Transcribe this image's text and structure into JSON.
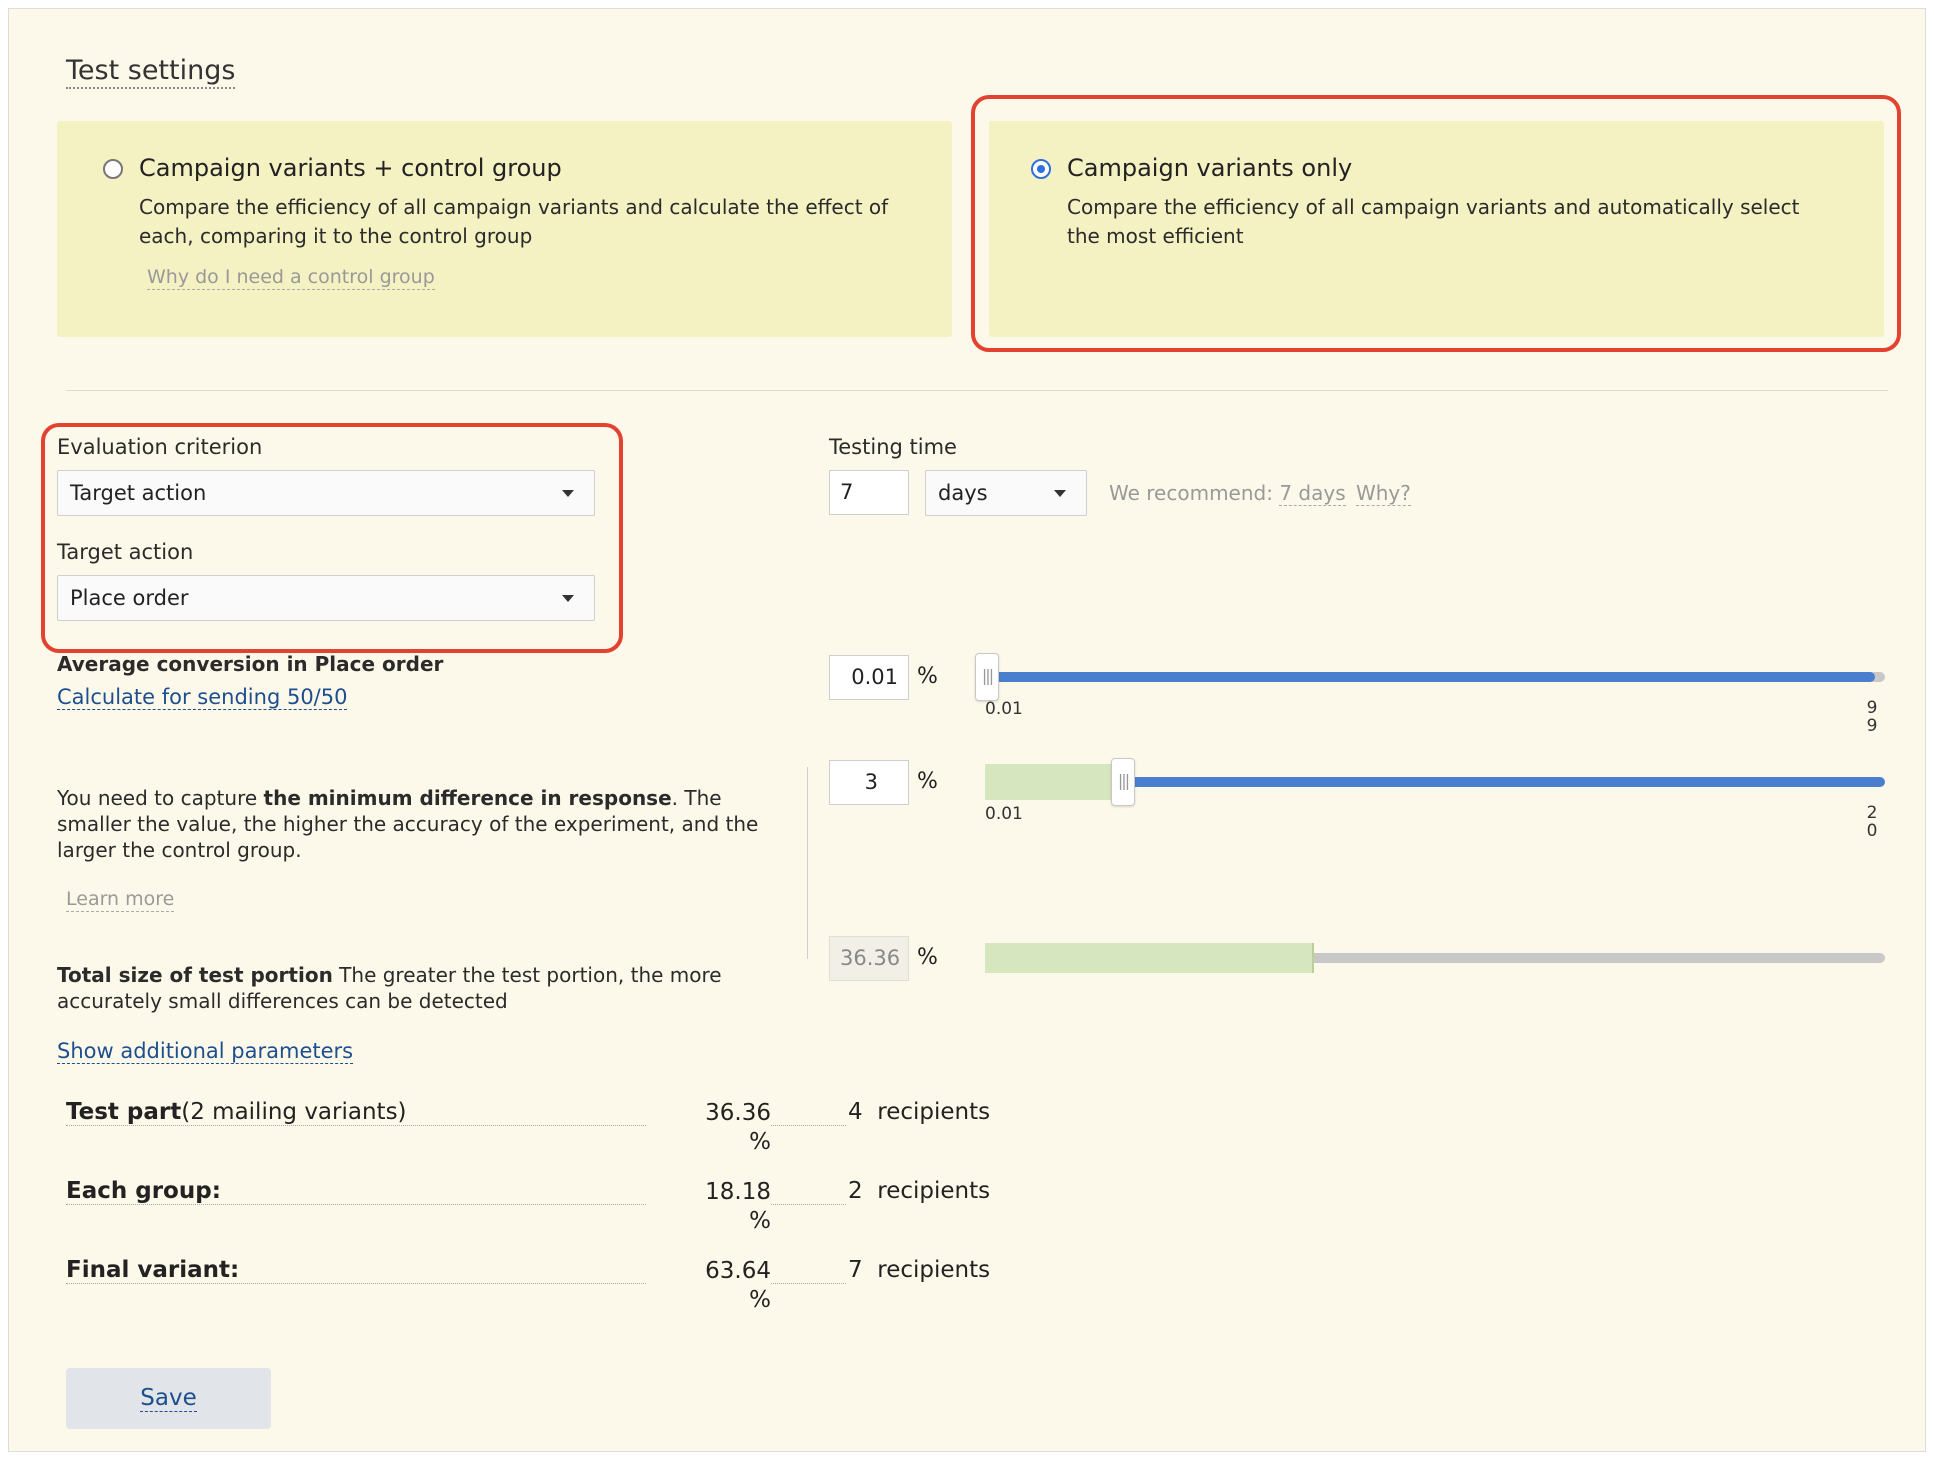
{
  "section_title": "Test settings",
  "options": [
    {
      "title": "Campaign variants + control group",
      "description": "Compare the efficiency of all campaign variants and calculate the effect of each, comparing it to the control group",
      "link": "Why do I need a control group",
      "selected": false
    },
    {
      "title": "Campaign variants only",
      "description": "Compare the efficiency of all campaign variants and automatically select the most efficient",
      "selected": true
    }
  ],
  "evaluation": {
    "label": "Evaluation criterion",
    "value": "Target action"
  },
  "target_action": {
    "label": "Target action",
    "value": "Place order"
  },
  "testing_time": {
    "label": "Testing time",
    "value": "7",
    "unit": "days",
    "recommend_prefix": "We recommend:",
    "recommend_value": "7 days",
    "why": "Why?"
  },
  "avg_conversion": {
    "label": "Average conversion in Place order",
    "link": "Calculate for sending 50/50",
    "value": "0.01",
    "unit": "%",
    "min": "0.01",
    "max": "99",
    "fraction": 0.0
  },
  "min_difference": {
    "text_prefix": "You need to capture ",
    "text_bold": "the minimum difference in response",
    "text_suffix": ". The smaller the value, the higher the accuracy of the experiment, and the larger the control group.",
    "link": "Learn more",
    "value": "3",
    "unit": "%",
    "min": "0.01",
    "max": "20",
    "fraction": 0.15
  },
  "test_portion": {
    "label_bold": "Total size of test portion",
    "label_rest": " The greater the test portion, the more accurately small differences can be detected",
    "value": "36.36",
    "unit": "%",
    "fraction": 0.3636
  },
  "show_more": "Show additional parameters",
  "summary": [
    {
      "label_bold": "Test part",
      "label_rest": "(2 mailing variants)",
      "pct": "36.36",
      "pct_unit": "%",
      "count": "4",
      "unit": "recipients"
    },
    {
      "label_bold": "Each group:",
      "label_rest": "",
      "pct": "18.18",
      "pct_unit": "%",
      "count": "2",
      "unit": "recipients"
    },
    {
      "label_bold": "Final variant:",
      "label_rest": "",
      "pct": "63.64",
      "pct_unit": "%",
      "count": "7",
      "unit": "recipients"
    }
  ],
  "save_label": "Save",
  "colors": {
    "highlight": "#e2422f",
    "slider_blue": "#4a7fd0",
    "slider_green": "#d6e6bf",
    "slider_grey": "#c8c8c8",
    "panel_bg": "#fdf9ea",
    "card_bg": "#f4f1c2"
  }
}
